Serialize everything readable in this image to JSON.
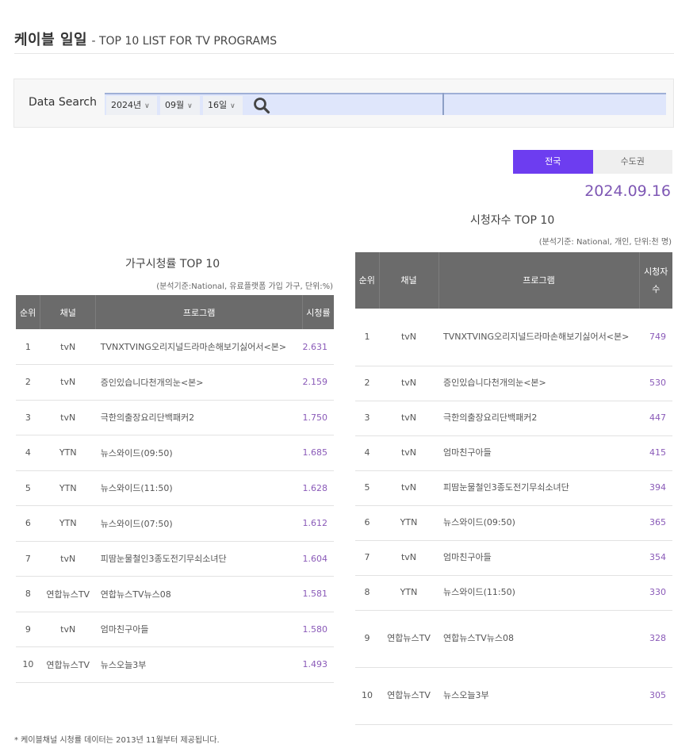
{
  "header": {
    "title_ko": "케이블 일일",
    "title_en": "- TOP 10 LIST FOR TV PROGRAMS"
  },
  "search": {
    "label": "Data Search",
    "year": "2024년",
    "month": "09월",
    "day": "16일",
    "chevron": "∨",
    "icon": "search-icon"
  },
  "region_tabs": [
    {
      "label": "전국",
      "active": true
    },
    {
      "label": "수도권",
      "active": false
    }
  ],
  "accent_color": "#6d3df0",
  "date": "2024.09.16",
  "household_ratings": {
    "title": "가구시청률 TOP 10",
    "note": "(분석기준:National, 유료플랫폼 가입 가구, 단위:%)",
    "columns": [
      "순위",
      "채널",
      "프로그램",
      "시청률"
    ],
    "rows": [
      {
        "rank": "1",
        "channel": "tvN",
        "program": "TVNXTVING오리지널드라마손해보기싫어서<본>",
        "value": "2.631"
      },
      {
        "rank": "2",
        "channel": "tvN",
        "program": "증인있습니다천개의눈<본>",
        "value": "2.159"
      },
      {
        "rank": "3",
        "channel": "tvN",
        "program": "극한의출장요리단백패커2",
        "value": "1.750"
      },
      {
        "rank": "4",
        "channel": "YTN",
        "program": "뉴스와이드(09:50)",
        "value": "1.685"
      },
      {
        "rank": "5",
        "channel": "YTN",
        "program": "뉴스와이드(11:50)",
        "value": "1.628"
      },
      {
        "rank": "6",
        "channel": "YTN",
        "program": "뉴스와이드(07:50)",
        "value": "1.612"
      },
      {
        "rank": "7",
        "channel": "tvN",
        "program": "피땀눈물철인3종도전기무쇠소녀단",
        "value": "1.604"
      },
      {
        "rank": "8",
        "channel": "연합뉴스TV",
        "program": "연합뉴스TV뉴스08",
        "value": "1.581"
      },
      {
        "rank": "9",
        "channel": "tvN",
        "program": "엄마친구아들",
        "value": "1.580"
      },
      {
        "rank": "10",
        "channel": "연합뉴스TV",
        "program": "뉴스오늘3부",
        "value": "1.493"
      }
    ]
  },
  "viewers": {
    "title": "시청자수 TOP 10",
    "note": "(분석기준: National, 개인, 단위:천 명)",
    "columns": [
      "순위",
      "채널",
      "프로그램",
      "시청자수"
    ],
    "rows": [
      {
        "rank": "1",
        "channel": "tvN",
        "program": "TVNXTVING오리지널드라마손해보기싫어서<본>",
        "value": "749"
      },
      {
        "rank": "2",
        "channel": "tvN",
        "program": "증인있습니다천개의눈<본>",
        "value": "530"
      },
      {
        "rank": "3",
        "channel": "tvN",
        "program": "극한의출장요리단백패커2",
        "value": "447"
      },
      {
        "rank": "4",
        "channel": "tvN",
        "program": "엄마친구아들",
        "value": "415"
      },
      {
        "rank": "5",
        "channel": "tvN",
        "program": "피땀눈물철인3종도전기무쇠소녀단",
        "value": "394"
      },
      {
        "rank": "6",
        "channel": "YTN",
        "program": "뉴스와이드(09:50)",
        "value": "365"
      },
      {
        "rank": "7",
        "channel": "tvN",
        "program": "엄마친구아들",
        "value": "354"
      },
      {
        "rank": "8",
        "channel": "YTN",
        "program": "뉴스와이드(11:50)",
        "value": "330"
      },
      {
        "rank": "9",
        "channel": "연합뉴스TV",
        "program": "연합뉴스TV뉴스08",
        "value": "328"
      },
      {
        "rank": "10",
        "channel": "연합뉴스TV",
        "program": "뉴스오늘3부",
        "value": "305"
      }
    ]
  },
  "footnote": "* 케이블채널 시청률 데이터는 2013년 11월부터 제공됩니다."
}
